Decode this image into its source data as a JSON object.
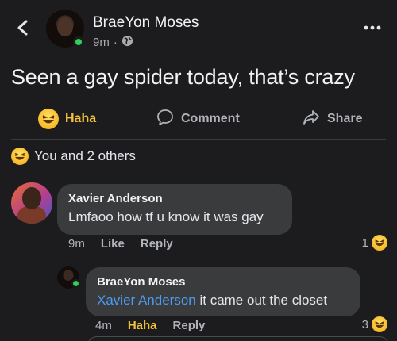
{
  "post": {
    "author": "BraeYon Moses",
    "time": "9m",
    "separator": "·",
    "text": "Seen a gay spider today, that’s crazy"
  },
  "actions": {
    "haha_label": "Haha",
    "comment_label": "Comment",
    "share_label": "Share"
  },
  "reactions": {
    "summary": "You and 2 others"
  },
  "comments": [
    {
      "author": "Xavier Anderson",
      "text": "Lmfaoo how tf u know it was gay",
      "time": "9m",
      "like_label": "Like",
      "reply_label": "Reply",
      "reaction_count": "1"
    }
  ],
  "replies": [
    {
      "author": "BraeYon Moses",
      "mention": "Xavier Anderson",
      "text": " it came out the closet",
      "time": "4m",
      "reaction_label": "Haha",
      "reply_label": "Reply",
      "reaction_count": "3"
    }
  ],
  "colors": {
    "background": "#1c1c1e",
    "haha": "#f5c33b",
    "mention": "#4d9bf2",
    "online": "#31d158"
  }
}
